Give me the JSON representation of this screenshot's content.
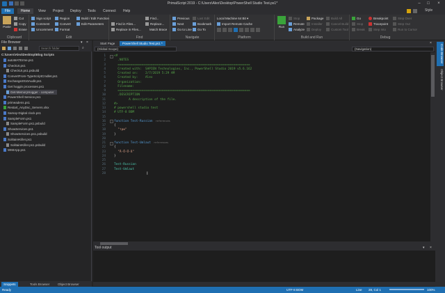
{
  "window": {
    "title": "PrimalScript 2019 - C:\\Users\\Alex\\Desktop\\PowerShell Studio Test.ps1*"
  },
  "menu": {
    "items": [
      "File",
      "Home",
      "View",
      "Project",
      "Deploy",
      "Tools",
      "Connect",
      "Help"
    ],
    "active": "Home",
    "style_label": "Style"
  },
  "ribbon": {
    "clipboard": {
      "label": "Clipboard",
      "paste": "Paste",
      "cut": "Cut",
      "copy": "Copy",
      "erase": "Erase"
    },
    "edit": {
      "label": "Edit",
      "sign_script": "Sign script",
      "comment": "Comment",
      "uncomment": "Uncomment",
      "region": "Region",
      "convert": "Convert",
      "format": "Format",
      "build_edit_function": "Build / Edit Function",
      "edit_parameters": "Edit Parameters"
    },
    "find": {
      "label": "Find",
      "find": "Find...",
      "find_in_files": "Find in Files...",
      "replace": "Replace...",
      "replace_in_files": "Replace in Files...",
      "match_brace": "Match Brace"
    },
    "navigate": {
      "label": "Navigate",
      "previous": "Previous",
      "next": "Next",
      "go_to_line": "Go to Line",
      "last_edit": "Last Edit",
      "bookmark": "Bookmark",
      "go_to": "Go To"
    },
    "platform": {
      "label": "Platform",
      "machine": "Local Machine 64 Bit",
      "import_cache": "Import Remote Cache"
    },
    "build_and_run": {
      "label": "Build and Run",
      "run": "Run",
      "stop": "Stop",
      "remote": "Remote",
      "analyze": "Analyze",
      "package": "Package",
      "installer": "Installer",
      "deploy": "Deploy",
      "build_all": "Build All",
      "cancel_build": "Cancel Build",
      "custom_tool": "Custom Tool"
    },
    "debug": {
      "label": "Debug",
      "go": "Go",
      "stop": "Stop",
      "break": "Break",
      "breakpoint": "Breakpoint",
      "tracepoint": "Tracepoint",
      "step_into": "Step Into",
      "step_over": "Step Over",
      "step_out": "Step Out",
      "run_to_cursor": "Run to Cursor"
    }
  },
  "file_browser": {
    "title": "File Browser",
    "search_placeholder": "Search folder",
    "root": "C:\\Users\\Alex\\Desktop\\Blog Scripts",
    "items": [
      "autoMATErme.ps1",
      "CheckUI.ps1",
      "CheckUI.ps1.psbuild",
      "ConvertFrom-TypeScriptCmdlet.ps1",
      "Exchange2010Audit.ps1",
      "Get hoggin processes.ps1",
      "Get-MemoryHogger - computer",
      "PowerShell Service.ps1",
      "primeadens.ps1",
      "Restart_AnyDsc_Servers.xlsx",
      "Samay-Digital clock.ps1",
      "SampleForm.ps1",
      "SampleForm.ps1.psbuild",
      "ShowServices.ps1",
      "ShowServices.ps1.psbuild",
      "SolitaireKiller.ps1",
      "SolitaireKiller.ps1.psbuild",
      "WMIApp.ps1"
    ],
    "selected_index": 6,
    "tabs": [
      "Snippets",
      "Tools Browser",
      "Object Browser"
    ],
    "active_tab": "Snippets"
  },
  "document_tabs": [
    "Start Page",
    "PowerShell Studio Test.ps1 *"
  ],
  "active_document": "PowerShell Studio Test.ps1 *",
  "nav": {
    "scope": "(Global Scope)",
    "navigation": "(Navigation)"
  },
  "editor": {
    "lines": [
      {
        "n": "1",
        "text": "<#",
        "cls": "c-com"
      },
      {
        "n": "2",
        "text": "  .NOTES",
        "cls": "c-com"
      },
      {
        "n": "3",
        "text": "  ========================================================================",
        "cls": "c-com"
      },
      {
        "n": "4",
        "text": "  Created with:  SAPIEN Technologies, Inc., PowerShell Studio 2019 v5.6.162",
        "cls": "c-com"
      },
      {
        "n": "5",
        "text": "  Created on:    2/7/2019 5:29 AM",
        "cls": "c-com"
      },
      {
        "n": "6",
        "text": "  Created by:    Alex",
        "cls": "c-com"
      },
      {
        "n": "7",
        "text": "  Organization:",
        "cls": "c-com"
      },
      {
        "n": "8",
        "text": "  Filename:",
        "cls": "c-com"
      },
      {
        "n": "9",
        "text": "  ========================================================================",
        "cls": "c-com"
      },
      {
        "n": "10",
        "text": "  .DESCRIPTION",
        "cls": "c-com"
      },
      {
        "n": "11",
        "text": "        A description of the file.",
        "cls": "c-com"
      },
      {
        "n": "12",
        "text": "#>",
        "cls": "c-com"
      },
      {
        "n": "13",
        "text": "# powershell studio test",
        "cls": "c-com"
      },
      {
        "n": "14",
        "text": "# UTF-8 BOM",
        "cls": "c-com"
      },
      {
        "n": "15",
        "text": "",
        "cls": ""
      },
      {
        "n": "16",
        "text": "function Test-Russian",
        "cls": "c-kw",
        "ref": "references"
      },
      {
        "n": "17",
        "text": "{",
        "cls": ""
      },
      {
        "n": "18",
        "text": "  \"три\"",
        "cls": "c-str"
      },
      {
        "n": "19",
        "text": "}",
        "cls": ""
      },
      {
        "n": "20",
        "text": "",
        "cls": ""
      },
      {
        "n": "21",
        "text": "function Test-Umlaut",
        "cls": "c-kw",
        "ref": "references"
      },
      {
        "n": "22",
        "text": "{",
        "cls": ""
      },
      {
        "n": "23",
        "text": "  \"Ä-Ö-Ü-ß\"",
        "cls": "c-str"
      },
      {
        "n": "24",
        "text": "}",
        "cls": ""
      },
      {
        "n": "25",
        "text": "",
        "cls": ""
      },
      {
        "n": "26",
        "text": "Test-Russian",
        "cls": "c-fn"
      },
      {
        "n": "27",
        "text": "Test-Umlaut",
        "cls": "c-fn"
      },
      {
        "n": "28",
        "text": "",
        "cls": ""
      }
    ]
  },
  "right_panels": [
    "Code Browser",
    "Object Browser"
  ],
  "tool_output": {
    "title": "Tool output"
  },
  "status": {
    "ready": "Ready",
    "encoding": "UTF-8 BOM",
    "line": "Line",
    "position": "28, Col 1",
    "zoom": "100%"
  },
  "colors": {
    "accent": "#1f6fb2",
    "editor_bg": "#1e1e1e",
    "comment": "#57a64a",
    "keyword": "#569cd6"
  }
}
